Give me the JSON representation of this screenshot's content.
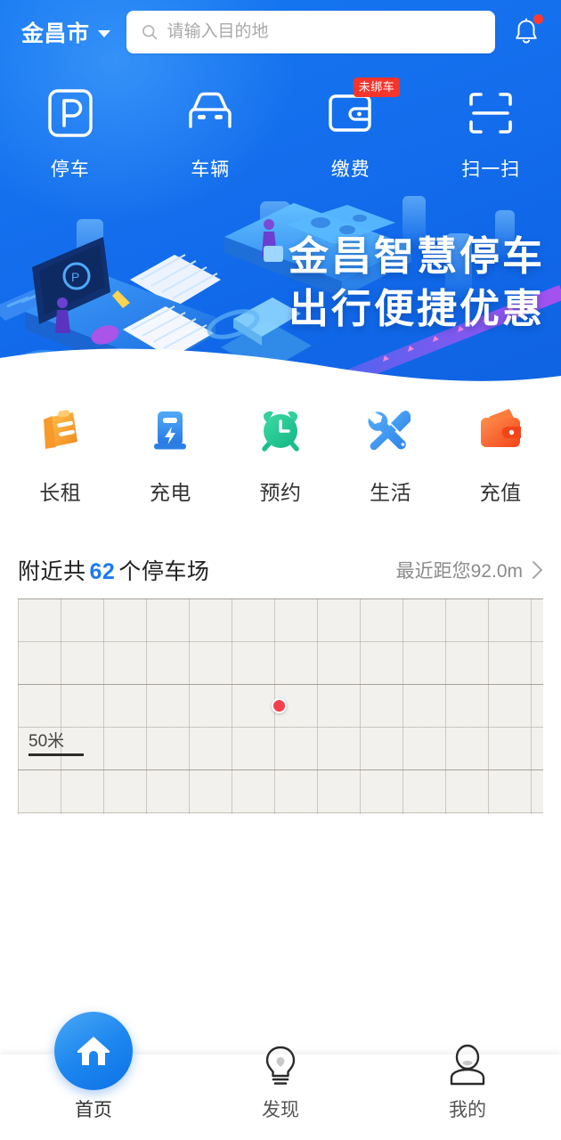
{
  "header": {
    "city": "金昌市",
    "city_caret_icon": "chevron-down-icon",
    "search_icon": "search-icon",
    "search_placeholder": "请输入目的地",
    "search_value": "",
    "bell_icon": "bell-icon",
    "bell_has_unread": true
  },
  "quick_nav": [
    {
      "label": "停车",
      "icon": "parking-p-icon",
      "badge": ""
    },
    {
      "label": "车辆",
      "icon": "car-icon",
      "badge": ""
    },
    {
      "label": "缴费",
      "icon": "wallet-outline-icon",
      "badge": "未绑车"
    },
    {
      "label": "扫一扫",
      "icon": "scan-icon",
      "badge": ""
    }
  ],
  "banner": {
    "slogan_line1": "金昌智慧停车",
    "slogan_line2": "出行便捷优惠",
    "illustration": "isometric-smart-parking-illustration"
  },
  "services": [
    {
      "label": "长租",
      "icon": "clipboard-icon",
      "color": "#f5a623"
    },
    {
      "label": "充电",
      "icon": "charging-station-icon",
      "color": "#3b9bf0"
    },
    {
      "label": "预约",
      "icon": "alarm-clock-icon",
      "color": "#1fc48a"
    },
    {
      "label": "生活",
      "icon": "tools-icon",
      "color": "#3b9bf0"
    },
    {
      "label": "充值",
      "icon": "wallet-filled-icon",
      "color": "#f4602a"
    }
  ],
  "nearby": {
    "prefix": "附近共",
    "count": "62",
    "suffix": "个停车场",
    "distance_text": "最近距您92.0m",
    "chevron_icon": "chevron-right-icon"
  },
  "map": {
    "scale_label": "50米",
    "marker_icon": "location-dot-marker"
  },
  "bottom_nav": [
    {
      "label": "首页",
      "icon": "home-icon",
      "active": true
    },
    {
      "label": "发现",
      "icon": "lightbulb-icon",
      "active": false
    },
    {
      "label": "我的",
      "icon": "person-icon",
      "active": false
    }
  ],
  "colors": {
    "brand_blue": "#1477f0",
    "accent_blue": "#1a7bf0",
    "badge_red": "#f5342b",
    "marker_red": "#f5404b"
  }
}
